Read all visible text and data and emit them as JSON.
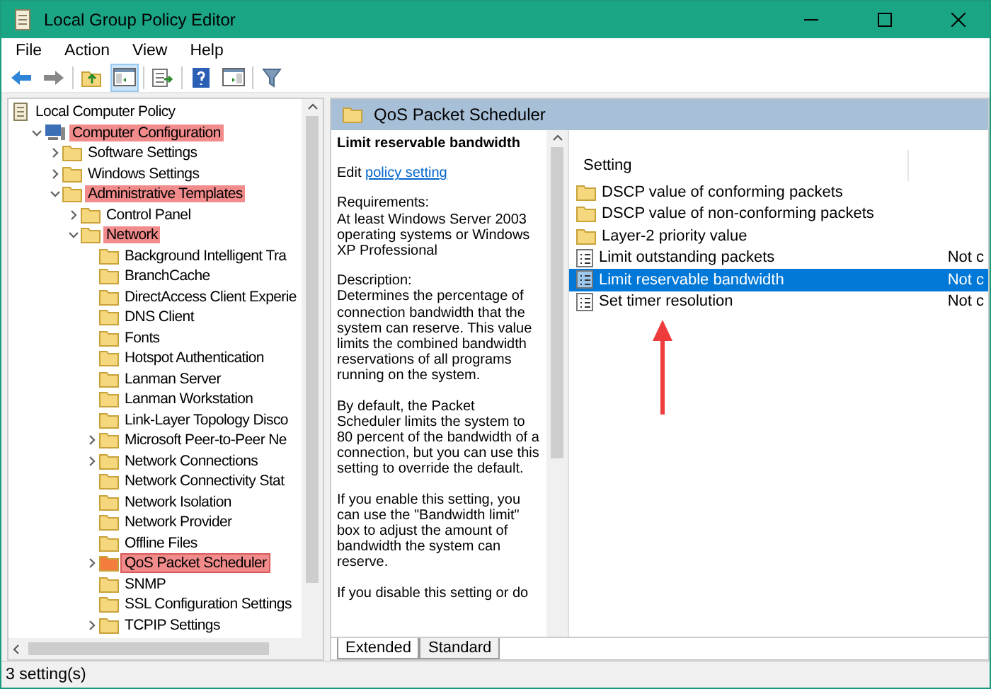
{
  "window": {
    "title": "Local Group Policy Editor"
  },
  "menu": [
    "File",
    "Action",
    "View",
    "Help"
  ],
  "toolbar": [
    {
      "kind": "back"
    },
    {
      "kind": "forward"
    },
    {
      "kind": "sep"
    },
    {
      "kind": "up"
    },
    {
      "kind": "tree",
      "pressed": true
    },
    {
      "kind": "sep"
    },
    {
      "kind": "export"
    },
    {
      "kind": "sep"
    },
    {
      "kind": "help"
    },
    {
      "kind": "pane"
    },
    {
      "kind": "sep"
    },
    {
      "kind": "filter"
    }
  ],
  "tree": {
    "label": "Local Computer Policy",
    "kind": "policy",
    "selected": false,
    "highlighted": false,
    "children": [
      {
        "label": "Computer Configuration",
        "kind": "computer",
        "expanded": true,
        "selected": false,
        "highlighted": true,
        "children": [
          {
            "label": "Software Settings",
            "kind": "folder",
            "expanded": false,
            "selected": false,
            "highlighted": false
          },
          {
            "label": "Windows Settings",
            "kind": "folder",
            "expanded": false,
            "selected": false,
            "highlighted": false
          },
          {
            "label": "Administrative Templates",
            "kind": "folder",
            "expanded": true,
            "selected": false,
            "highlighted": true,
            "children": [
              {
                "label": "Control Panel",
                "kind": "folder",
                "expanded": false,
                "selected": false,
                "highlighted": false
              },
              {
                "label": "Network",
                "kind": "folder",
                "expanded": true,
                "selected": false,
                "highlighted": true,
                "children": [
                  {
                    "label": "Background Intelligent Tra",
                    "kind": "folder",
                    "selected": false,
                    "highlighted": false
                  },
                  {
                    "label": "BranchCache",
                    "kind": "folder",
                    "selected": false,
                    "highlighted": false
                  },
                  {
                    "label": "DirectAccess Client Experie",
                    "kind": "folder",
                    "selected": false,
                    "highlighted": false
                  },
                  {
                    "label": "DNS Client",
                    "kind": "folder",
                    "selected": false,
                    "highlighted": false
                  },
                  {
                    "label": "Fonts",
                    "kind": "folder",
                    "selected": false,
                    "highlighted": false
                  },
                  {
                    "label": "Hotspot Authentication",
                    "kind": "folder",
                    "selected": false,
                    "highlighted": false
                  },
                  {
                    "label": "Lanman Server",
                    "kind": "folder",
                    "selected": false,
                    "highlighted": false
                  },
                  {
                    "label": "Lanman Workstation",
                    "kind": "folder",
                    "selected": false,
                    "highlighted": false
                  },
                  {
                    "label": "Link-Layer Topology Disco",
                    "kind": "folder",
                    "selected": false,
                    "highlighted": false
                  },
                  {
                    "label": "Microsoft Peer-to-Peer Ne",
                    "kind": "folder",
                    "expanded": false,
                    "selected": false,
                    "highlighted": false
                  },
                  {
                    "label": "Network Connections",
                    "kind": "folder",
                    "expanded": false,
                    "selected": false,
                    "highlighted": false
                  },
                  {
                    "label": "Network Connectivity Stat",
                    "kind": "folder",
                    "selected": false,
                    "highlighted": false
                  },
                  {
                    "label": "Network Isolation",
                    "kind": "folder",
                    "selected": false,
                    "highlighted": false
                  },
                  {
                    "label": "Network Provider",
                    "kind": "folder",
                    "selected": false,
                    "highlighted": false
                  },
                  {
                    "label": "Offline Files",
                    "kind": "folder",
                    "selected": false,
                    "highlighted": false
                  },
                  {
                    "label": "QoS Packet Scheduler",
                    "kind": "folder",
                    "expanded": false,
                    "selected": true,
                    "highlighted": true
                  },
                  {
                    "label": "SNMP",
                    "kind": "folder",
                    "selected": false,
                    "highlighted": false
                  },
                  {
                    "label": "SSL Configuration Settings",
                    "kind": "folder",
                    "selected": false,
                    "highlighted": false
                  },
                  {
                    "label": "TCPIP Settings",
                    "kind": "folder",
                    "expanded": false,
                    "selected": false,
                    "highlighted": false
                  }
                ]
              }
            ]
          }
        ]
      }
    ]
  },
  "pane_header": "QoS Packet Scheduler",
  "description": {
    "title": "Limit reservable bandwidth",
    "edit_prefix": "Edit",
    "edit_link": "policy setting",
    "paragraphs": [
      "Requirements:\nAt least Windows Server 2003 operating systems or Windows XP Professional",
      "Description:\nDetermines the percentage of connection bandwidth that the system can reserve. This value limits the combined bandwidth reservations of all programs running on the system.",
      "By default, the Packet Scheduler limits the system to 80 percent of the bandwidth of a connection, but you can use this setting to override the default.",
      "If you enable this setting, you can use the \"Bandwidth limit\" box to adjust the amount of bandwidth the system can reserve.",
      "If you disable this setting or do"
    ]
  },
  "table": {
    "columns": [
      "Setting"
    ],
    "rows": [
      {
        "kind": "folder",
        "name": "DSCP value of conforming packets",
        "selected": false
      },
      {
        "kind": "folder",
        "name": "DSCP value of non-conforming packets",
        "selected": false
      },
      {
        "kind": "folder",
        "name": "Layer-2 priority value",
        "selected": false
      },
      {
        "kind": "policy",
        "name": "Limit outstanding packets",
        "state": "Not c",
        "selected": false
      },
      {
        "kind": "policy",
        "name": "Limit reservable bandwidth",
        "state": "Not c",
        "selected": true
      },
      {
        "kind": "policy",
        "name": "Set timer resolution",
        "state": "Not c",
        "selected": false
      }
    ]
  },
  "tabs": [
    {
      "label": "Extended",
      "selected": true
    },
    {
      "label": "Standard",
      "selected": false
    }
  ],
  "status_bar": "3 setting(s)"
}
